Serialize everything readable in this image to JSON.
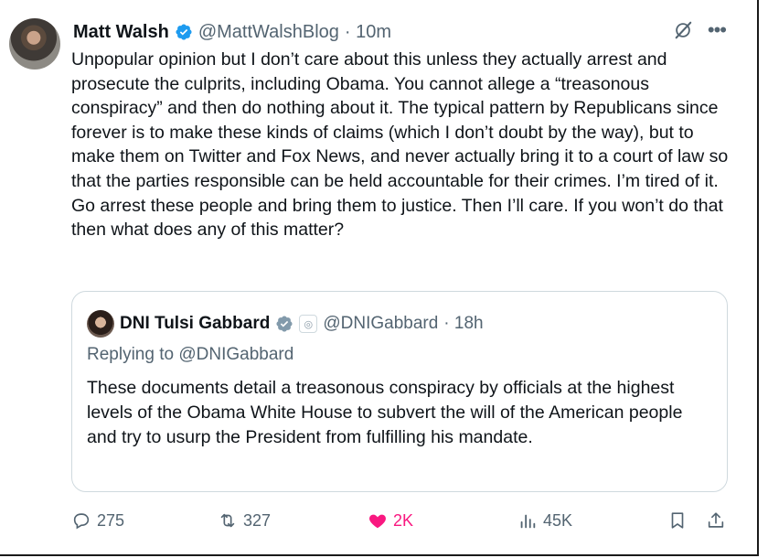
{
  "tweet": {
    "author_name": "Matt Walsh",
    "handle": "@MattWalshBlog",
    "time": "· 10m",
    "text": "Unpopular opinion but I don’t care about this unless they actually arrest and prosecute the culprits, including Obama. You cannot allege a “treasonous conspiracy” and then do nothing about it. The typical pattern by Republicans since forever is to make these kinds of claims (which I don’t doubt by the way), but to make them on Twitter and Fox News, and never actually bring it to a court of law so that the parties responsible can be held accountable for their crimes. I’m tired of it. Go arrest these people and bring them to justice. Then I’ll care. If you won’t do that then what does any of this matter?"
  },
  "quote": {
    "author_name": "DNI Tulsi Gabbard",
    "handle": "@DNIGabbard",
    "time": "· 18h",
    "replying_to": "Replying to @DNIGabbard",
    "text": "These documents detail a treasonous conspiracy by officials at the highest levels of the Obama White House to subvert the will of the American people and try to usurp the President from fulfilling his mandate."
  },
  "actions": {
    "replies": "275",
    "reposts": "327",
    "likes": "2K",
    "views": "45K"
  },
  "colors": {
    "verified_blue": "#1d9bf0",
    "gov_gray": "#829aab",
    "like_pink": "#f91880",
    "secondary": "#536471"
  },
  "icons": [
    "verified-icon",
    "grok-icon",
    "more-icon",
    "government-badge-icon",
    "affiliate-icon",
    "reply-icon",
    "repost-icon",
    "heart-icon",
    "views-icon",
    "bookmark-icon",
    "share-icon"
  ]
}
